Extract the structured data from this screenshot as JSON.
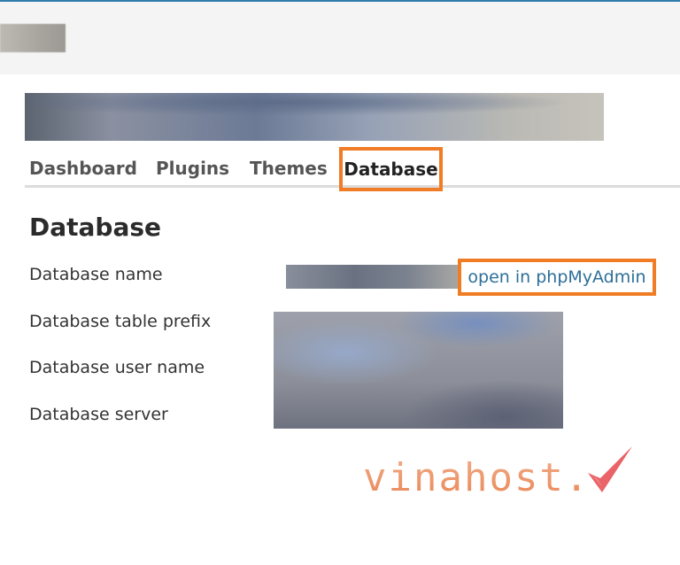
{
  "tabs": {
    "dashboard": "Dashboard",
    "plugins": "Plugins",
    "themes": "Themes",
    "database": "Database"
  },
  "section": {
    "title": "Database"
  },
  "fields": {
    "name_label": "Database name",
    "prefix_label": "Database table prefix",
    "user_label": "Database user name",
    "server_label": "Database server",
    "pma_link": "open in phpMyAdmin"
  },
  "watermark": {
    "text": "vinahost."
  },
  "colors": {
    "accent_highlight": "#f07d26",
    "link": "#2d6f99",
    "top_border": "#2f7cad"
  }
}
